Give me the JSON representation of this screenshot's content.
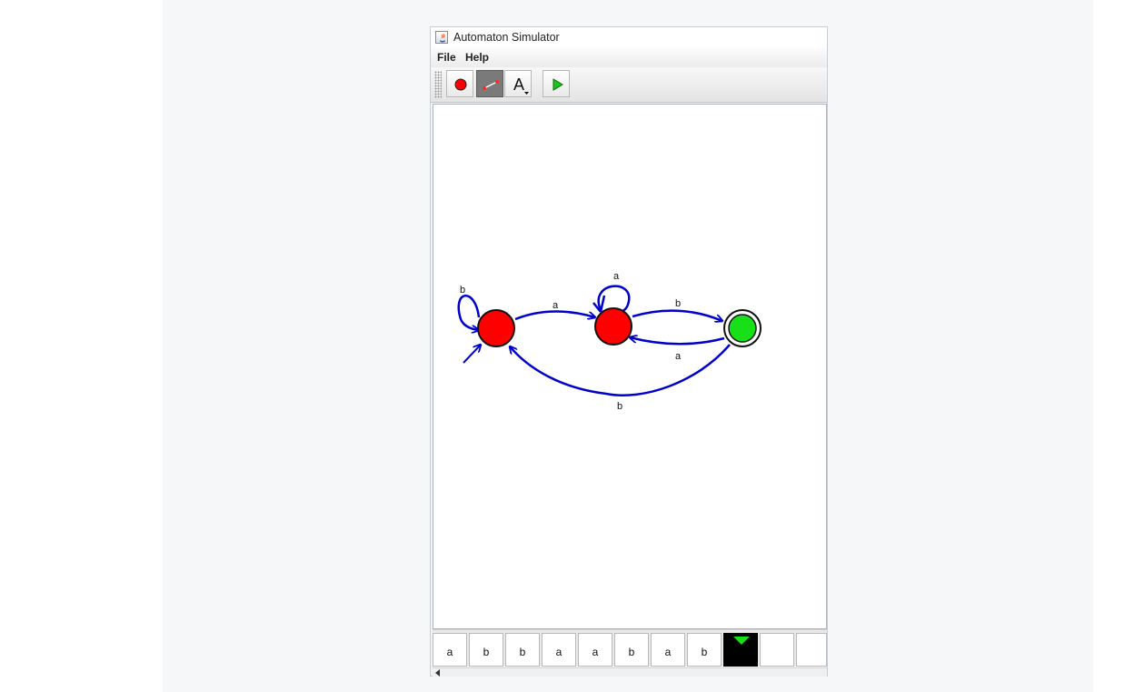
{
  "window": {
    "title": "Automaton Simulator",
    "app_icon": "java-coffee-icon"
  },
  "menubar": {
    "items": [
      "File",
      "Help"
    ]
  },
  "toolbar": {
    "tools": [
      {
        "name": "add-state-tool",
        "icon": "red-circle-icon",
        "selected": false
      },
      {
        "name": "add-transition-tool",
        "icon": "transition-arrow-icon",
        "selected": true
      },
      {
        "name": "label-tool",
        "icon": "text-a-icon",
        "label": "A",
        "selected": false
      },
      {
        "name": "run-tool",
        "icon": "play-icon",
        "selected": false
      }
    ]
  },
  "automaton": {
    "states": [
      {
        "id": "q0",
        "start": true,
        "accepting": false,
        "color": "#ff0000"
      },
      {
        "id": "q1",
        "start": false,
        "accepting": false,
        "color": "#ff0000"
      },
      {
        "id": "q2",
        "start": false,
        "accepting": true,
        "color": "#18e018"
      }
    ],
    "transitions": [
      {
        "from": "q0",
        "to": "q0",
        "symbol": "b"
      },
      {
        "from": "q0",
        "to": "q1",
        "symbol": "a"
      },
      {
        "from": "q1",
        "to": "q1",
        "symbol": "a"
      },
      {
        "from": "q1",
        "to": "q2",
        "symbol": "b"
      },
      {
        "from": "q2",
        "to": "q1",
        "symbol": "a"
      },
      {
        "from": "q2",
        "to": "q0",
        "symbol": "b"
      }
    ],
    "edge_color": "#0000cc"
  },
  "tape": {
    "cells": [
      "a",
      "b",
      "b",
      "a",
      "a",
      "b",
      "a",
      "b",
      "",
      "",
      ""
    ],
    "head_index": 8,
    "head_color": "#18e018"
  }
}
